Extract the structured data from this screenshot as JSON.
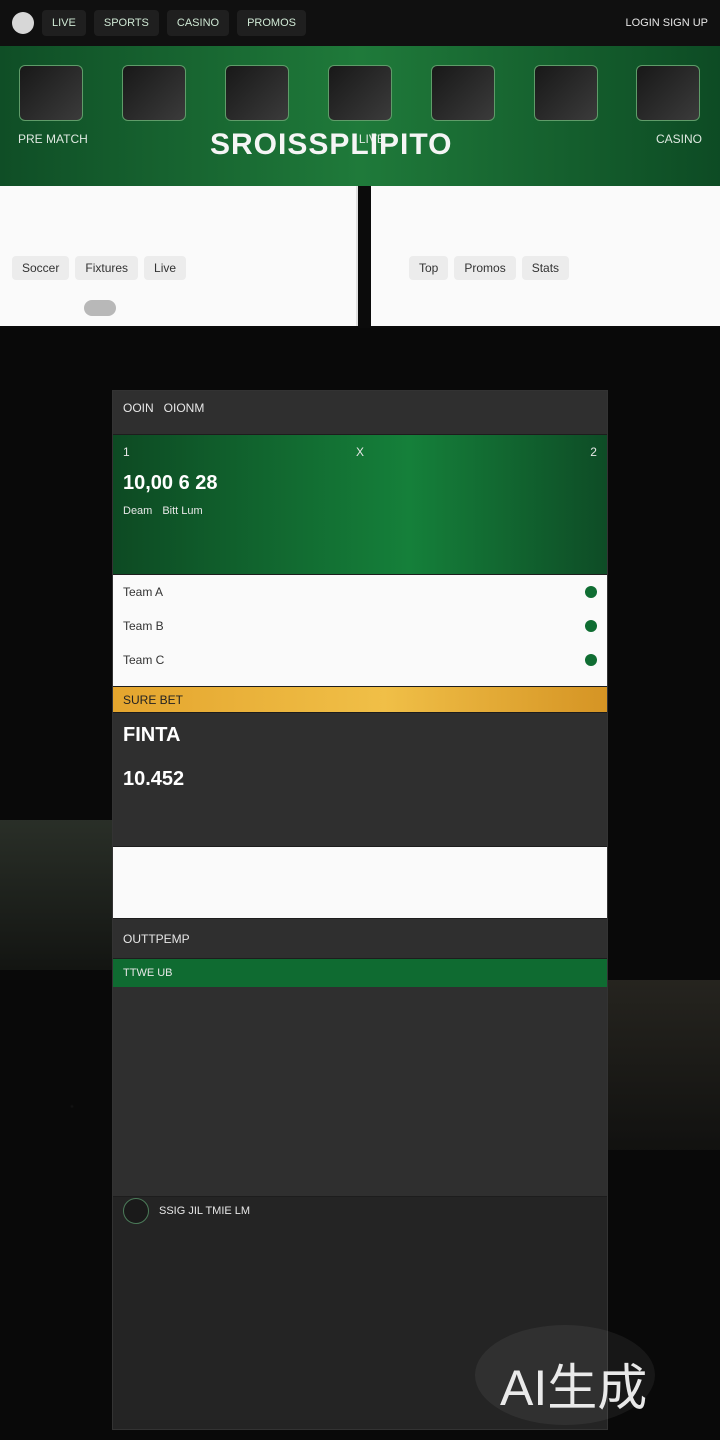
{
  "hero": {
    "title": "SROISSPLIPITO",
    "labels": [
      "PRE MATCH",
      "LIVE",
      "CASINO"
    ]
  },
  "nav": {
    "items": [
      "LIVE",
      "SPORTS",
      "CASINO",
      "PROMOS"
    ],
    "right_label": "LOGIN SIGN UP"
  },
  "cards": {
    "left_labels": [
      "Soccer",
      "Fixtures",
      "Live"
    ],
    "right_labels": [
      "Top",
      "Promos",
      "Stats"
    ]
  },
  "panel": {
    "header": [
      "OOIN",
      "OIONM"
    ],
    "match_row": [
      "1",
      "X",
      "2"
    ],
    "score": "10,00 6 28",
    "market": [
      "Deam",
      "Bitt Lum"
    ],
    "list": [
      "Team A",
      "Team B",
      "Team C"
    ],
    "promo": "SURE BET",
    "summary": [
      "FINTA",
      "10.452"
    ],
    "bottom": [
      "OUTTPEMP",
      "TTWE UB",
      "SSIG JIL TMIE LM"
    ]
  },
  "badge": "AI生成"
}
